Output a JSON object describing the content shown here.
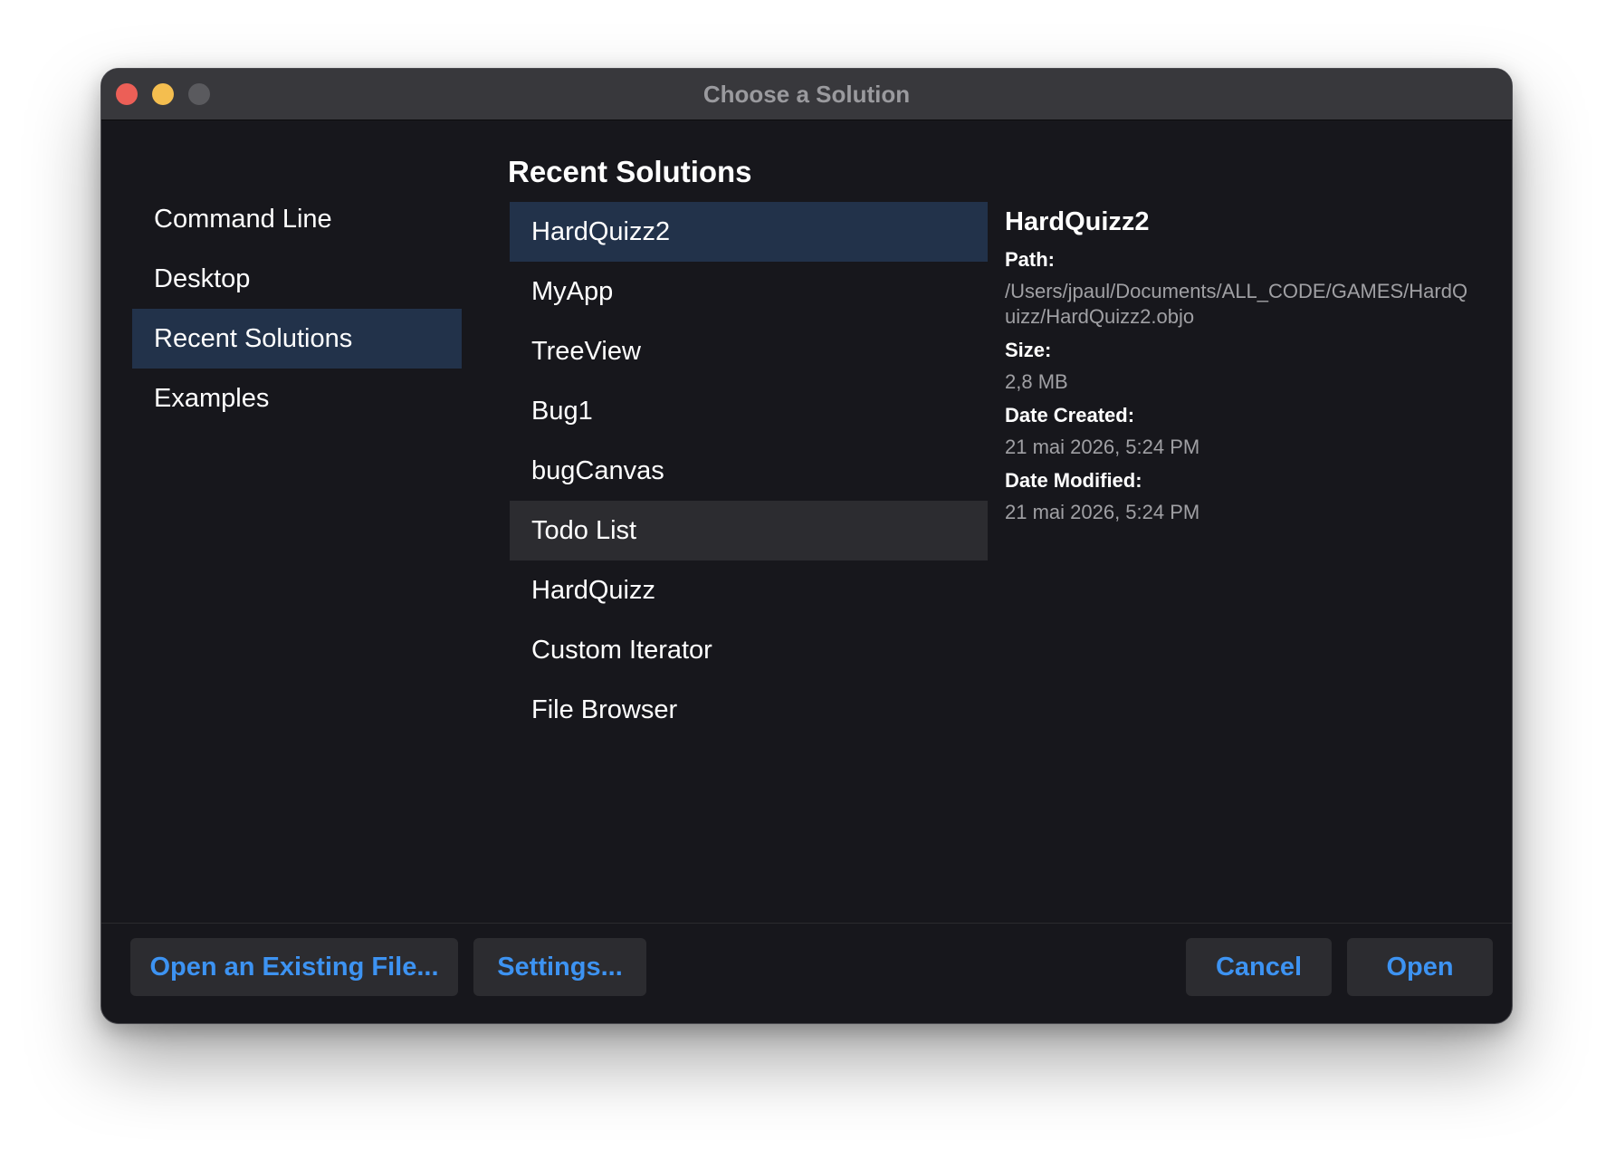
{
  "window": {
    "title": "Choose a Solution"
  },
  "sidebar": {
    "items": [
      {
        "label": "Command Line"
      },
      {
        "label": "Desktop"
      },
      {
        "label": "Recent Solutions",
        "selected": true
      },
      {
        "label": "Examples"
      }
    ]
  },
  "main": {
    "section_title": "Recent Solutions",
    "solutions": [
      {
        "label": "HardQuizz2",
        "selected": true
      },
      {
        "label": "MyApp"
      },
      {
        "label": "TreeView"
      },
      {
        "label": "Bug1"
      },
      {
        "label": "bugCanvas"
      },
      {
        "label": "Todo List",
        "hovered": true
      },
      {
        "label": "HardQuizz"
      },
      {
        "label": "Custom Iterator"
      },
      {
        "label": "File Browser"
      }
    ]
  },
  "details": {
    "name": "HardQuizz2",
    "path_label": "Path:",
    "path_value": "/Users/jpaul/Documents/ALL_CODE/GAMES/HardQuizz/HardQuizz2.objo",
    "size_label": "Size:",
    "size_value": "2,8 MB",
    "created_label": "Date Created:",
    "created_value": "21 mai 2026, 5:24 PM",
    "modified_label": "Date Modified:",
    "modified_value": "21 mai 2026, 5:24 PM"
  },
  "footer": {
    "open_existing_label": "Open an Existing File...",
    "settings_label": "Settings...",
    "cancel_label": "Cancel",
    "open_label": "Open"
  },
  "colors": {
    "window_bg": "#17171c",
    "titlebar_bg": "#38383c",
    "selection_bg": "#22324a",
    "hover_bg": "#2c2c30",
    "accent_blue": "#3d93f2",
    "close_red": "#ec5f57",
    "minimize_yellow": "#f4be4f",
    "maximize_gray": "#5a5a5e"
  }
}
